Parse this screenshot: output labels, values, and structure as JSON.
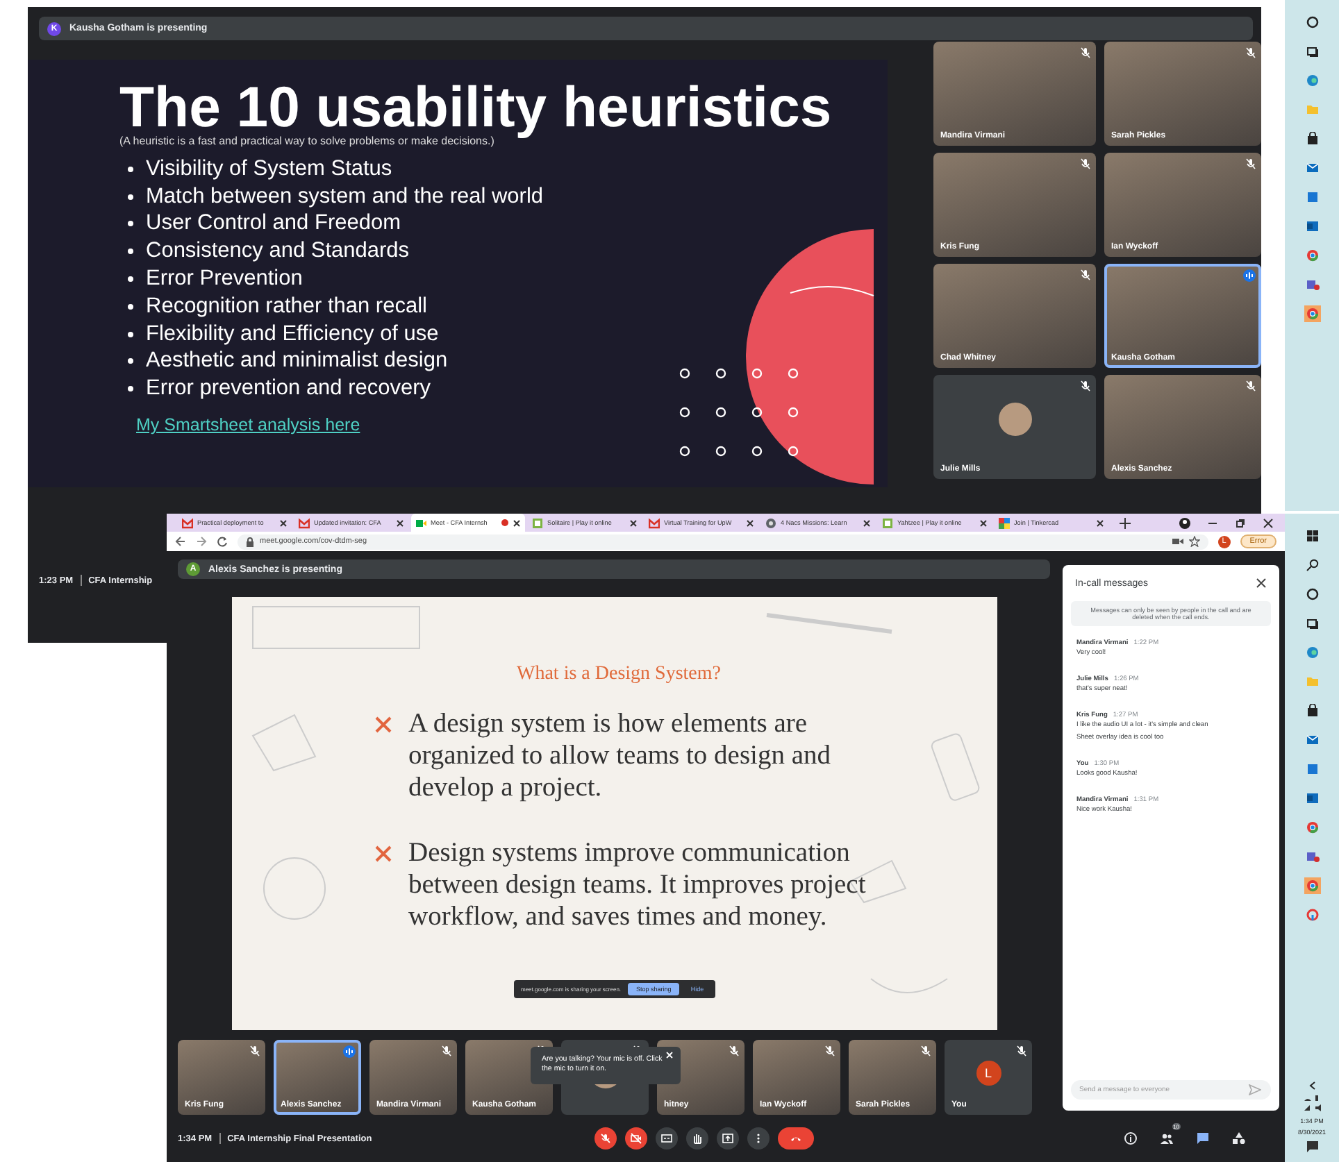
{
  "back_window": {
    "presenting_bar": {
      "avatar_letter": "K",
      "text": "Kausha Gotham is presenting"
    },
    "slide": {
      "title": "The 10 usability heuristics",
      "subtitle": "(A heuristic is a fast and practical way to solve problems or make decisions.)",
      "bullets": [
        "Visibility of System Status",
        "Match between system and the real world",
        "User Control and Freedom",
        "Consistency and Standards",
        "Error Prevention",
        "Recognition rather than recall",
        "Flexibility and Efficiency of use",
        "Aesthetic and minimalist design",
        "Error prevention and recovery"
      ],
      "link": "My Smartsheet analysis here"
    },
    "tiles": [
      {
        "name": "Mandira Virmani",
        "kind": "video",
        "speaking": false
      },
      {
        "name": "Sarah Pickles",
        "kind": "video",
        "speaking": false
      },
      {
        "name": "Kris Fung",
        "kind": "video",
        "speaking": false
      },
      {
        "name": "Ian Wyckoff",
        "kind": "video",
        "speaking": false
      },
      {
        "name": "Chad Whitney",
        "kind": "video",
        "speaking": false
      },
      {
        "name": "Kausha Gotham",
        "kind": "video",
        "speaking": true
      },
      {
        "name": "Julie Mills",
        "kind": "avatar",
        "speaking": false
      },
      {
        "name": "Alexis Sanchez",
        "kind": "video",
        "speaking": false
      }
    ],
    "footer": {
      "time": "1:23 PM",
      "meeting": "CFA Internship"
    }
  },
  "front_window": {
    "tabs": [
      {
        "label": "Practical deployment to",
        "kind": "mail",
        "selected": false
      },
      {
        "label": "Updated invitation: CFA",
        "kind": "mail",
        "selected": false
      },
      {
        "label": "Meet - CFA Internsh",
        "kind": "meet",
        "selected": true
      },
      {
        "label": "Solitaire | Play it online",
        "kind": "game",
        "selected": false
      },
      {
        "label": "Virtual Training for UpW",
        "kind": "mail",
        "selected": false
      },
      {
        "label": "4 Nacs Missions: Learn",
        "kind": "globe",
        "selected": false
      },
      {
        "label": "Yahtzee | Play it online",
        "kind": "game",
        "selected": false
      },
      {
        "label": "Join | Tinkercad",
        "kind": "tinkercad",
        "selected": false
      }
    ],
    "address_bar": {
      "url": "meet.google.com/cov-dtdm-seg",
      "profile_letter": "L",
      "error_label": "Error"
    },
    "presenting_bar": {
      "avatar_letter": "A",
      "text": "Alexis Sanchez is presenting"
    },
    "slide": {
      "title": "What is a Design System?",
      "bullets": [
        "A design system is how elements are organized to allow teams to design and develop a project.",
        "Design systems improve communication between design teams. It improves project workflow, and saves times and money."
      ],
      "sharing_bar": {
        "text": "meet.google.com is sharing your screen.",
        "stop": "Stop sharing",
        "hide": "Hide"
      }
    },
    "tiles": [
      {
        "name": "Kris Fung",
        "kind": "video",
        "speaking": false
      },
      {
        "name": "Alexis Sanchez",
        "kind": "video",
        "speaking": true
      },
      {
        "name": "Mandira Virmani",
        "kind": "video",
        "speaking": false
      },
      {
        "name": "Kausha Gotham",
        "kind": "video",
        "speaking": false
      },
      {
        "kind": "avatar",
        "speaking": false
      },
      {
        "name": "hitney",
        "kind": "video",
        "speaking": false
      },
      {
        "name": "Ian Wyckoff",
        "kind": "video",
        "speaking": false
      },
      {
        "name": "Sarah Pickles",
        "kind": "video",
        "speaking": false
      },
      {
        "name": "You",
        "kind": "letter",
        "avatar_letter": "L",
        "speaking": false
      }
    ],
    "tooltip": {
      "text": "Are you talking? Your mic is off. Click the mic to turn it on."
    },
    "chat": {
      "title": "In-call messages",
      "notice": "Messages can only be seen by people in the call and are deleted when the call ends.",
      "messages": [
        {
          "sender": "Mandira Virmani",
          "time": "1:22 PM",
          "lines": [
            "Very cool!"
          ]
        },
        {
          "sender": "Julie Mills",
          "time": "1:26 PM",
          "lines": [
            "that's super neat!"
          ]
        },
        {
          "sender": "Kris Fung",
          "time": "1:27 PM",
          "lines": [
            "I like the audio UI a lot - it's simple and clean",
            "Sheet overlay idea is cool too"
          ]
        },
        {
          "sender": "You",
          "time": "1:30 PM",
          "lines": [
            "Looks good Kausha!"
          ]
        },
        {
          "sender": "Mandira Virmani",
          "time": "1:31 PM",
          "lines": [
            "Nice work Kausha!"
          ]
        }
      ],
      "input": {
        "placeholder": "Send a message to everyone"
      }
    },
    "bottom_bar": {
      "time": "1:34 PM",
      "meeting": "CFA Internship Final Presentation",
      "controls": [
        {
          "kind": "mic",
          "off": true
        },
        {
          "kind": "camera",
          "off": true
        },
        {
          "kind": "captions",
          "off": false
        },
        {
          "kind": "hand",
          "off": false
        },
        {
          "kind": "present",
          "off": false
        },
        {
          "kind": "more",
          "off": false
        },
        {
          "kind": "hangup"
        }
      ],
      "side_buttons": [
        {
          "kind": "info",
          "selected": false
        },
        {
          "kind": "people",
          "badge": "10",
          "selected": false
        },
        {
          "kind": "chat",
          "selected": true
        },
        {
          "kind": "activities",
          "selected": false
        }
      ]
    }
  },
  "taskbar": {
    "time": "1:34 PM",
    "date": "8/30/2021"
  }
}
